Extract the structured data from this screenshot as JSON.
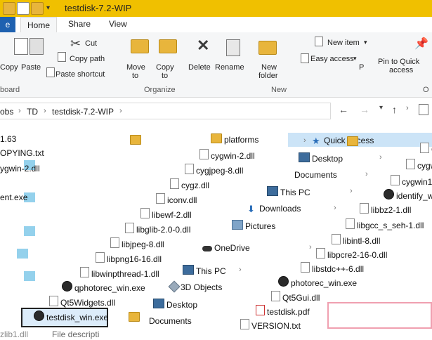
{
  "window": {
    "title": "testdisk-7.2-WIP"
  },
  "tabs": [
    "e",
    "Home",
    "Share",
    "View"
  ],
  "ribbon": {
    "cut": "Cut",
    "copy_path": "Copy path",
    "paste_shortcut": "Paste shortcut",
    "copy_left": "Copy",
    "paste": "Paste",
    "move_to_1": "Move",
    "move_to_2": "to",
    "copy_to_1": "Copy",
    "copy_to_2": "to",
    "delete": "Delete",
    "rename": "Rename",
    "new_folder_1": "New",
    "new_folder_2": "folder",
    "new_item": "New item",
    "easy_access": "Easy access",
    "p_label": "P",
    "pin_1": "Pin to Quick",
    "pin_2": "access",
    "groups": {
      "clipboard": "board",
      "organize": "Organize",
      "new": "New",
      "open": "O"
    }
  },
  "address": {
    "crumbs": [
      "obs",
      "TD",
      "testdisk-7.2-WIP"
    ]
  },
  "content": {
    "items": [
      {
        "label": "1.63",
        "icon": "folder"
      },
      {
        "label": "OPYING.txt",
        "icon": "txt"
      },
      {
        "label": "ygwin-2.dll",
        "icon": "dll"
      },
      {
        "label": "ent.exe",
        "icon": "exe"
      },
      {
        "label": "platforms",
        "icon": "folder"
      },
      {
        "label": "cygwin-2.dll",
        "icon": "dll"
      },
      {
        "label": "cygjpeg-8.dll",
        "icon": "dll"
      },
      {
        "label": "cygz.dll",
        "icon": "dll"
      },
      {
        "label": "iconv.dll",
        "icon": "dll"
      },
      {
        "label": "libewf-2.dll",
        "icon": "dll"
      },
      {
        "label": "libglib-2.0-0.dll",
        "icon": "dll"
      },
      {
        "label": "libjpeg-8.dll",
        "icon": "dll"
      },
      {
        "label": "libpng16-16.dll",
        "icon": "dll"
      },
      {
        "label": "libwinpthread-1.dll",
        "icon": "dll"
      },
      {
        "label": "qphotorec_win.exe",
        "icon": "exe"
      },
      {
        "label": "Qt5Widgets.dll",
        "icon": "dll"
      },
      {
        "label": "testdisk_win.exe",
        "icon": "exe"
      },
      {
        "label": "Quick access",
        "icon": "star"
      },
      {
        "label": "Desktop",
        "icon": "desktop"
      },
      {
        "label": "Documents",
        "icon": "doc"
      },
      {
        "label": "This PC",
        "icon": "pc"
      },
      {
        "label": "Downloads",
        "icon": "download"
      },
      {
        "label": "Pictures",
        "icon": "pictures"
      },
      {
        "label": "OneDrive",
        "icon": "cloud"
      },
      {
        "label": "This PC",
        "icon": "pc"
      },
      {
        "label": "3D Objects",
        "icon": "objects"
      },
      {
        "label": "Desktop",
        "icon": "desktop"
      },
      {
        "label": "Documents",
        "icon": "doc"
      },
      {
        "label": "cygwin1.",
        "icon": "dll"
      },
      {
        "label": "cygwin1",
        "icon": "dll"
      },
      {
        "label": "identify_win",
        "icon": "exe"
      },
      {
        "label": "libbz2-1.dll",
        "icon": "dll"
      },
      {
        "label": "libgcc_s_seh-1.dll",
        "icon": "dll"
      },
      {
        "label": "libintl-8.dll",
        "icon": "dll"
      },
      {
        "label": "libpcre2-16-0.dll",
        "icon": "dll"
      },
      {
        "label": "libstdc++-6.dll",
        "icon": "dll"
      },
      {
        "label": "photorec_win.exe",
        "icon": "exe"
      },
      {
        "label": "Qt5Gui.dll",
        "icon": "dll"
      },
      {
        "label": "testdisk.pdf",
        "icon": "pdf"
      },
      {
        "label": "VERSION.txt",
        "icon": "txt"
      },
      {
        "label": "File descripti",
        "icon": "none"
      },
      {
        "label": "zlib1.dll",
        "icon": "dll"
      }
    ]
  }
}
